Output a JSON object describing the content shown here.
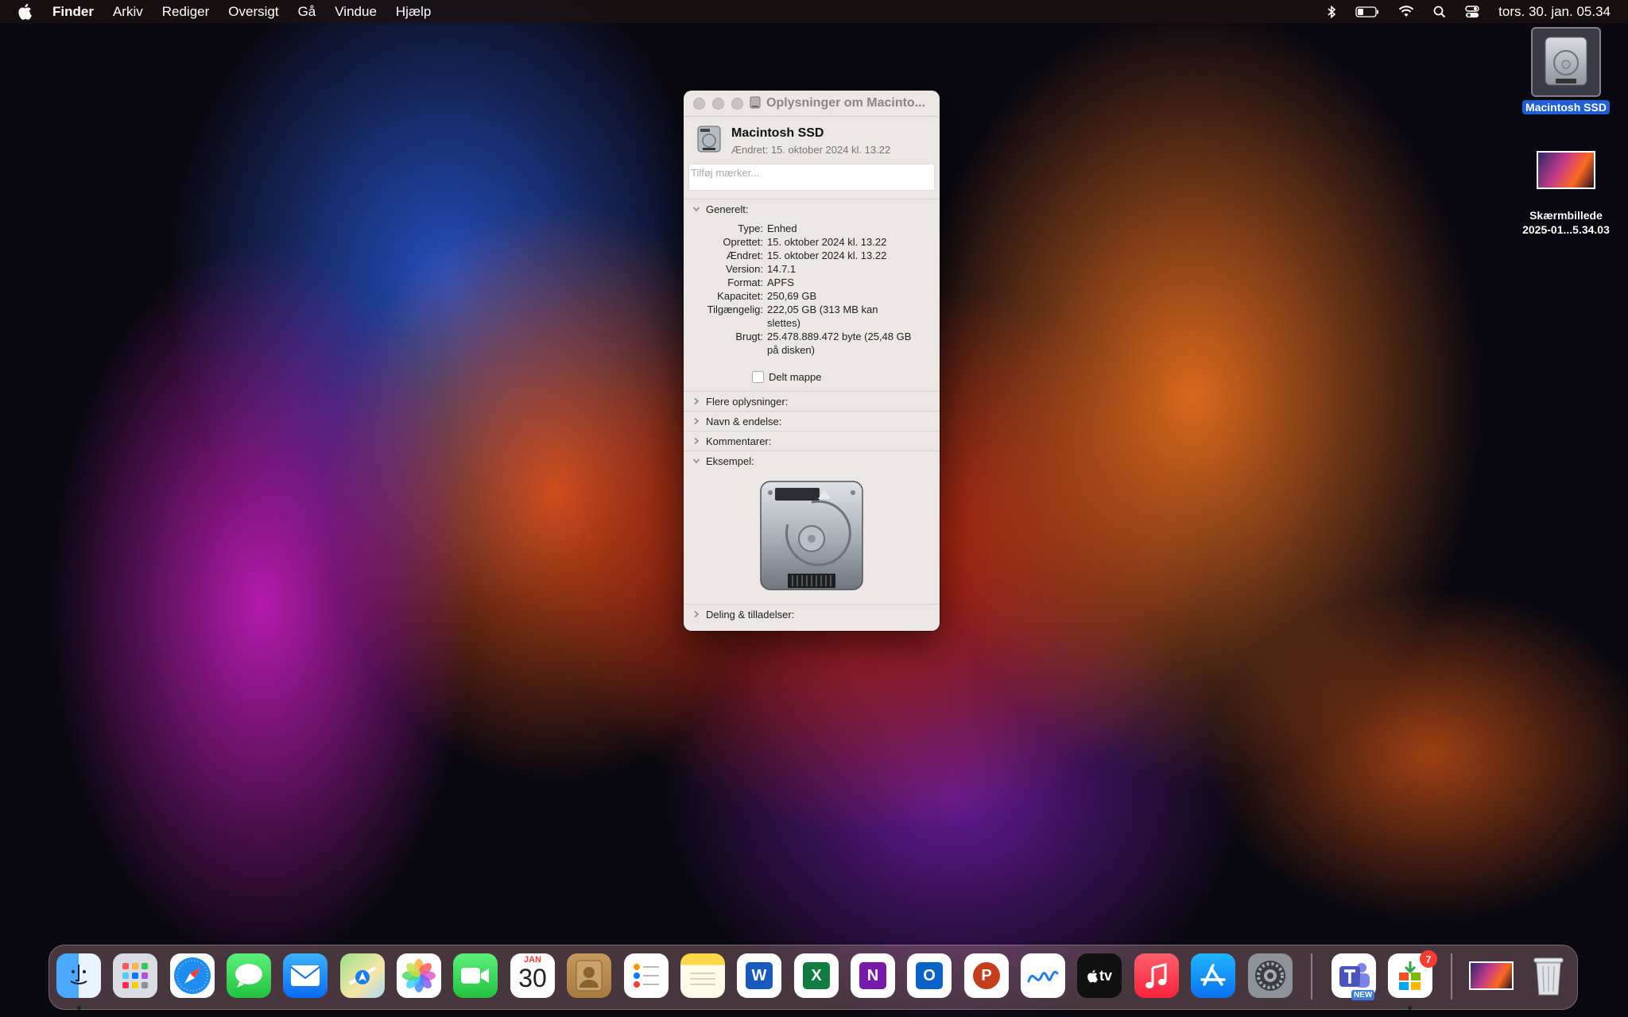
{
  "menubar": {
    "app": "Finder",
    "items": [
      "Arkiv",
      "Rediger",
      "Oversigt",
      "Gå",
      "Vindue",
      "Hjælp"
    ],
    "clock": "tors. 30. jan. 05.34"
  },
  "desktop": {
    "ssd_label": "Macintosh SSD",
    "screenshot_label_1": "Skærmbillede",
    "screenshot_label_2": "2025-01...5.34.03"
  },
  "info_window": {
    "title": "Oplysninger om Macinto...",
    "name": "Macintosh SSD",
    "modified_line": "Ændret: 15. oktober 2024 kl. 13.22",
    "tags_placeholder": "Tilføj mærker...",
    "general_header": "Generelt:",
    "general": [
      {
        "key": "Type:",
        "value": "Enhed"
      },
      {
        "key": "Oprettet:",
        "value": "15. oktober 2024 kl. 13.22"
      },
      {
        "key": "Ændret:",
        "value": "15. oktober 2024 kl. 13.22"
      },
      {
        "key": "Version:",
        "value": "14.7.1"
      },
      {
        "key": "Format:",
        "value": "APFS"
      },
      {
        "key": "Kapacitet:",
        "value": "250,69 GB"
      },
      {
        "key": "Tilgængelig:",
        "value": "222,05 GB (313 MB kan slettes)"
      },
      {
        "key": "Brugt:",
        "value": "25.478.889.472 byte (25,48 GB på disken)"
      }
    ],
    "shared_folder": "Delt mappe",
    "sections": [
      "Flere oplysninger:",
      "Navn & endelse:",
      "Kommentarer:"
    ],
    "preview_header": "Eksempel:",
    "sharing_header": "Deling & tilladelser:"
  },
  "dock": {
    "calendar_month": "JAN",
    "calendar_day": "30",
    "store_badge": "7",
    "teams_tag": "NEW",
    "word_letter": "W",
    "excel_letter": "X",
    "onenote_letter": "N",
    "outlook_letter": "O",
    "ppt_letter": "P",
    "tv_label": "tv"
  },
  "colors": {
    "selection": "#1f5fd6",
    "window_bg": "#ece6e4",
    "badge": "#ff3b30"
  }
}
